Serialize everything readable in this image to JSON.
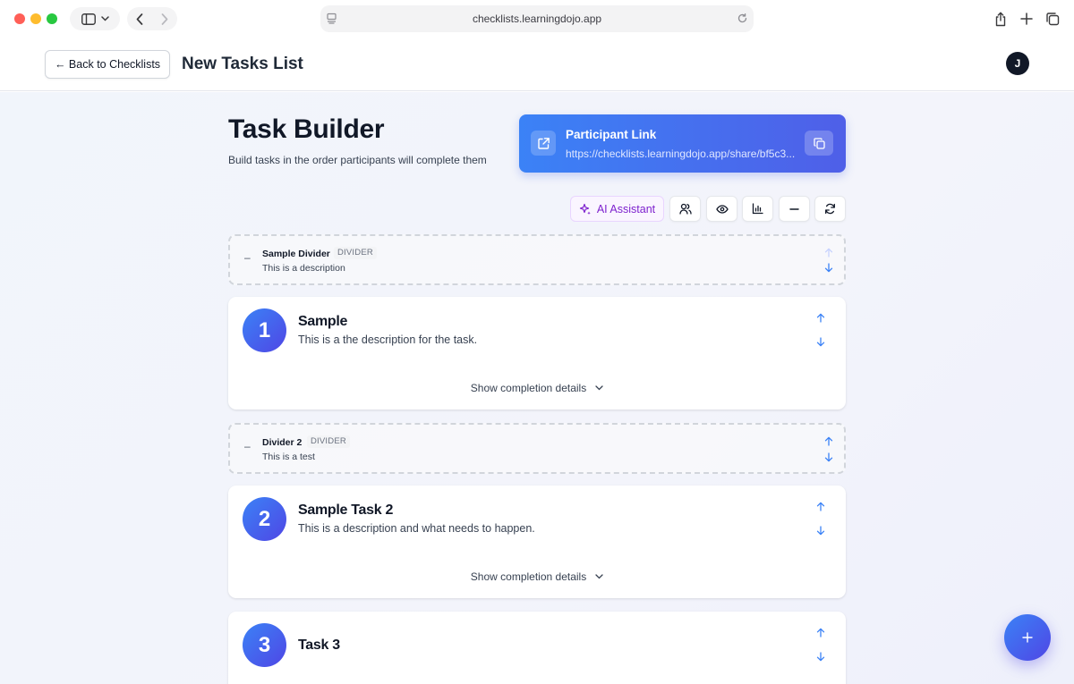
{
  "browser": {
    "url": "checklists.learningdojo.app"
  },
  "header": {
    "back_label": "← Back to Checklists",
    "title": "New Tasks List",
    "avatar_initial": "J"
  },
  "builder": {
    "title": "Task Builder",
    "subtitle": "Build tasks in the order participants will complete them"
  },
  "participant_link": {
    "title": "Participant Link",
    "url": "https://checklists.learningdojo.app/share/bf5c3..."
  },
  "toolbar": {
    "ai_label": "AI Assistant",
    "icons": [
      "users-icon",
      "eye-icon",
      "bar-chart-icon",
      "minus-icon",
      "refresh-icon"
    ]
  },
  "items": {
    "divider1": {
      "title": "Sample Divider",
      "badge": "DIVIDER",
      "desc": "This is a description",
      "dash": "–"
    },
    "task1": {
      "number": "1",
      "title": "Sample",
      "desc": "This is a the description for the task.",
      "details": "Show completion details"
    },
    "divider2": {
      "title": "Divider 2",
      "badge": "DIVIDER",
      "desc": "This is a test",
      "dash": "–"
    },
    "task2": {
      "number": "2",
      "title": "Sample Task 2",
      "desc": "This is a description and what needs to happen.",
      "details": "Show completion details"
    },
    "task3": {
      "number": "3",
      "title": "Task 3"
    }
  },
  "colors": {
    "accent_blue": "#3b82f6",
    "accent_indigo": "#4f46e5",
    "ai_purple": "#7e22ce"
  }
}
